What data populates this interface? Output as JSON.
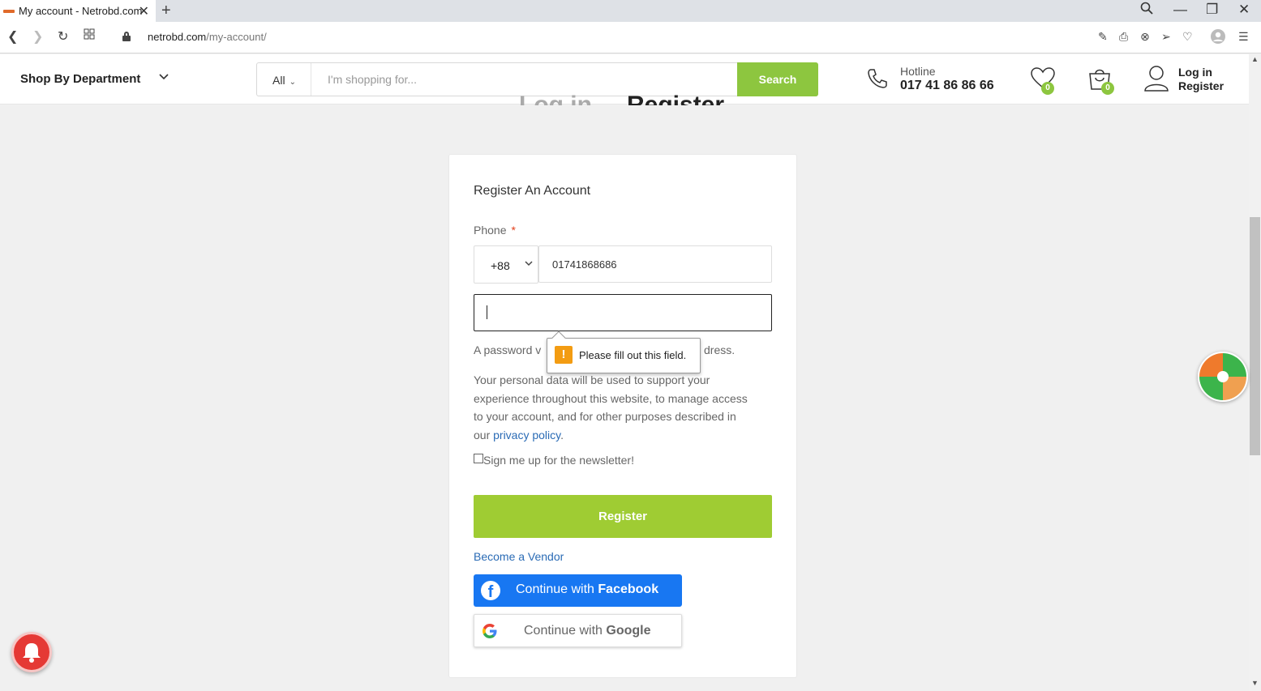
{
  "browser": {
    "tab_title": "My account - Netrobd.com",
    "url_host": "netrobd.com",
    "url_path": "/my-account/"
  },
  "header": {
    "department_label": "Shop By Department",
    "search": {
      "category": "All",
      "placeholder": "I'm shopping for...",
      "button_label": "Search"
    },
    "hotline_label": "Hotline",
    "hotline_number": "017 41 86 86 66",
    "wishlist_count": "0",
    "cart_count": "0",
    "account_login": "Log in",
    "account_register": "Register"
  },
  "page_tabs": {
    "login": "Log in",
    "register": "Register"
  },
  "form": {
    "title": "Register An Account",
    "phone_label": "Phone",
    "required_mark": "*",
    "country_code": "+88",
    "phone_value": "01741868686",
    "email_value": "",
    "password_note_start": "A password v",
    "password_note_end": "dress.",
    "tooltip_text": "Please fill out this field.",
    "privacy_text": "Your personal data will be used to support your experience throughout this website, to manage access to your account, and for other purposes described in our",
    "privacy_link": "privacy policy",
    "privacy_end": ".",
    "newsletter_label": "Sign me up for the newsletter!",
    "register_button": "Register",
    "vendor_link": "Become a Vendor",
    "facebook_prefix": "Continue with",
    "facebook_brand": "Facebook",
    "google_prefix": "Continue with",
    "google_brand": "Google"
  },
  "colors": {
    "accent_green": "#9fcc33",
    "search_green": "#8dc63f",
    "facebook_blue": "#1877f2",
    "link_blue": "#2a6bb5",
    "notification_red": "#e53935"
  }
}
